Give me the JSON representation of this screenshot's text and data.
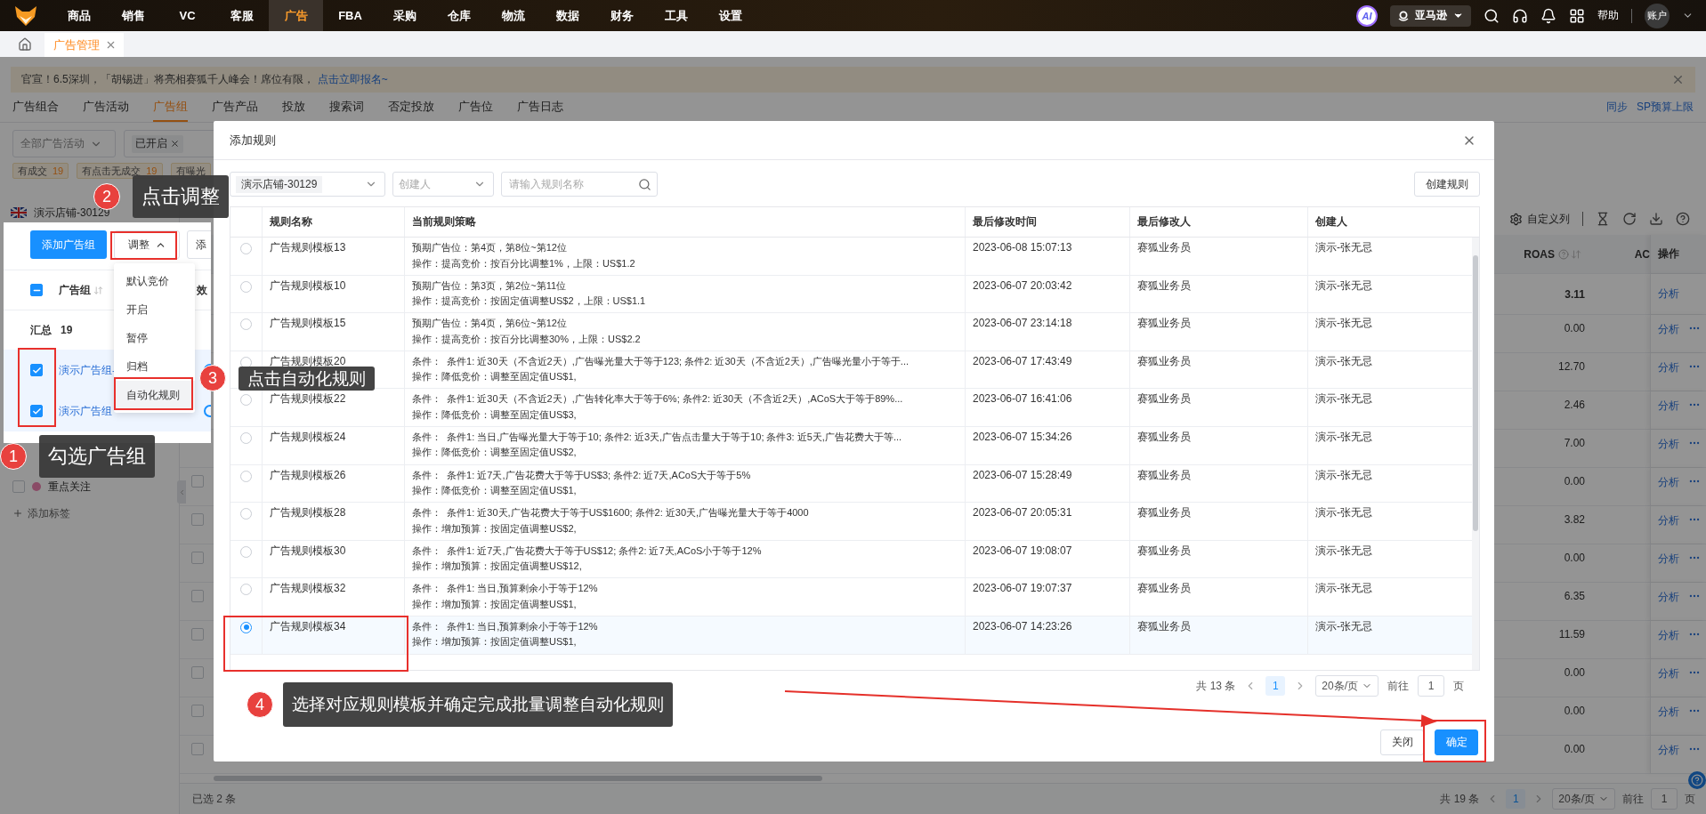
{
  "nav": {
    "items": [
      {
        "label": "商品",
        "selected": false
      },
      {
        "label": "销售",
        "selected": false
      },
      {
        "label": "VC",
        "selected": false
      },
      {
        "label": "客服",
        "selected": false
      },
      {
        "label": "广告",
        "selected": true
      },
      {
        "label": "FBA",
        "selected": false
      },
      {
        "label": "采购",
        "selected": false
      },
      {
        "label": "仓库",
        "selected": false
      },
      {
        "label": "物流",
        "selected": false
      },
      {
        "label": "数据",
        "selected": false
      },
      {
        "label": "财务",
        "selected": false
      },
      {
        "label": "工具",
        "selected": false
      },
      {
        "label": "设置",
        "selected": false
      }
    ],
    "ai": "AI",
    "platform": "亚马逊",
    "help": "帮助",
    "account": "账户"
  },
  "page_tabs": [
    {
      "label": "广告管理",
      "selected": true
    }
  ],
  "banner": {
    "text": "官宣！6.5深圳，「胡锡进」将亮相赛狐千人峰会！席位有限，",
    "link": "点击立即报名~"
  },
  "sub_tabs": [
    {
      "label": "广告组合",
      "selected": false
    },
    {
      "label": "广告活动",
      "selected": false
    },
    {
      "label": "广告组",
      "selected": true
    },
    {
      "label": "广告产品",
      "selected": false
    },
    {
      "label": "投放",
      "selected": false
    },
    {
      "label": "搜索词",
      "selected": false
    },
    {
      "label": "否定投放",
      "selected": false
    },
    {
      "label": "广告位",
      "selected": false
    },
    {
      "label": "广告日志",
      "selected": false
    }
  ],
  "sub_actions": [
    "同步",
    "SP预算上限"
  ],
  "filters": {
    "campaign": "全部广告活动",
    "status_tag": "已开启"
  },
  "quick_filters": [
    {
      "label": "有成交",
      "count": "19"
    },
    {
      "label": "有点击无成交",
      "count": "19"
    },
    {
      "label": "有曝光"
    }
  ],
  "sidebar": {
    "store": "演示店铺-30129",
    "tags": [
      {
        "label": "重点关注",
        "color": "#8a4b66",
        "checked": false
      }
    ],
    "add_tag": "添加标签"
  },
  "toolbar": {
    "custom_columns": "自定义列"
  },
  "table": {
    "columns": [
      "ROAS",
      "AC",
      "操作"
    ],
    "summary": {
      "roas": "3.11",
      "action": "分析"
    },
    "rows": [
      {
        "roas": "0.00",
        "action": "分析"
      },
      {
        "roas": "12.70",
        "action": "分析"
      },
      {
        "roas": "2.46",
        "action": "分析"
      },
      {
        "roas": "7.00",
        "action": "分析"
      },
      {
        "roas": "0.00",
        "action": "分析",
        "checked": false
      },
      {
        "roas": "3.82",
        "action": "分析",
        "checked": false
      },
      {
        "roas": "0.00",
        "action": "分析",
        "checked": false
      },
      {
        "roas": "6.35",
        "action": "分析",
        "checked": false
      },
      {
        "roas": "11.59",
        "action": "分析",
        "checked": false
      },
      {
        "roas": "0.00",
        "action": "分析",
        "checked": false
      },
      {
        "roas": "0.00",
        "action": "分析",
        "checked": false
      },
      {
        "roas": "0.00",
        "action": "分析",
        "checked": false
      }
    ]
  },
  "footer": {
    "selected": "已选 2 条",
    "total": "共 19 条",
    "page": "1",
    "page_size": "20条/页",
    "goto": "前往",
    "goto_value": "1",
    "goto_unit": "页"
  },
  "popup": {
    "add_button": "添加广告组",
    "adjust_button": "调整",
    "adjust_expanded": true,
    "next_button": "添",
    "header": {
      "label": "广告组",
      "indeterminate": true,
      "next_column": "效"
    },
    "summary": {
      "label": "汇总",
      "count": "19"
    },
    "rows": [
      {
        "name": "演示广告组-",
        "checked": true
      },
      {
        "name": "演示广告组",
        "checked": true
      }
    ],
    "menu": [
      {
        "label": "默认竞价",
        "selected": false
      },
      {
        "label": "开启",
        "selected": false
      },
      {
        "label": "暂停",
        "selected": false
      },
      {
        "label": "归档",
        "selected": false
      },
      {
        "label": "自动化规则",
        "selected": true
      }
    ]
  },
  "dialog": {
    "title": "添加规则",
    "store": "演示店铺-30129",
    "creator_placeholder": "创建人",
    "search_placeholder": "请输入规则名称",
    "create_button": "创建规则",
    "columns": [
      "规则名称",
      "当前规则策略",
      "最后修改时间",
      "最后修改人",
      "创建人"
    ],
    "rows": [
      {
        "name": "广告规则模板13",
        "strategy": [
          "预期广告位：第4页，第8位~第12位",
          "操作：提高竞价：按百分比调整1%，上限：US$1.2"
        ],
        "modified": "2023-06-08 15:07:13",
        "modifier": "赛狐业务员",
        "creator": "演示-张无忌",
        "selected": false
      },
      {
        "name": "广告规则模板10",
        "strategy": [
          "预期广告位：第3页，第2位~第11位",
          "操作：提高竞价：按固定值调整US$2，上限：US$1.1"
        ],
        "modified": "2023-06-07 20:03:42",
        "modifier": "赛狐业务员",
        "creator": "演示-张无忌",
        "selected": false
      },
      {
        "name": "广告规则模板15",
        "strategy": [
          "预期广告位：第4页，第6位~第12位",
          "操作：提高竞价：按百分比调整30%，上限：US$2.2"
        ],
        "modified": "2023-06-07 23:14:18",
        "modifier": "赛狐业务员",
        "creator": "演示-张无忌",
        "selected": false
      },
      {
        "name": "广告规则模板20",
        "strategy": [
          "条件：  条件1: 近30天（不含近2天）,广告曝光量大于等于123; 条件2: 近30天（不含近2天）,广告曝光量小于等于...",
          "操作：降低竞价：调整至固定值US$1,"
        ],
        "modified": "2023-06-07 17:43:49",
        "modifier": "赛狐业务员",
        "creator": "演示-张无忌",
        "selected": false
      },
      {
        "name": "广告规则模板22",
        "strategy": [
          "条件：  条件1: 近30天（不含近2天）,广告转化率大于等于6%; 条件2: 近30天（不含近2天）,ACoS大于等于89%...",
          "操作：降低竞价：调整至固定值US$3,"
        ],
        "modified": "2023-06-07 16:41:06",
        "modifier": "赛狐业务员",
        "creator": "演示-张无忌",
        "selected": false
      },
      {
        "name": "广告规则模板24",
        "strategy": [
          "条件：  条件1: 当日,广告曝光量大于等于10; 条件2: 近3天,广告点击量大于等于10; 条件3: 近5天,广告花费大于等...",
          "操作：降低竞价：调整至固定值US$2,"
        ],
        "modified": "2023-06-07 15:34:26",
        "modifier": "赛狐业务员",
        "creator": "演示-张无忌",
        "selected": false
      },
      {
        "name": "广告规则模板26",
        "strategy": [
          "条件：  条件1: 近7天,广告花费大于等于US$3; 条件2: 近7天,ACoS大于等于5%",
          "操作：降低竞价：调整至固定值US$1,"
        ],
        "modified": "2023-06-07 15:28:49",
        "modifier": "赛狐业务员",
        "creator": "演示-张无忌",
        "selected": false
      },
      {
        "name": "广告规则模板28",
        "strategy": [
          "条件：  条件1: 近30天,广告花费大于等于US$1600; 条件2: 近30天,广告曝光量大于等于4000",
          "操作：增加预算：按固定值调整US$2,"
        ],
        "modified": "2023-06-07 20:05:31",
        "modifier": "赛狐业务员",
        "creator": "演示-张无忌",
        "selected": false
      },
      {
        "name": "广告规则模板30",
        "strategy": [
          "条件：  条件1: 近7天,广告花费大于等于US$12; 条件2: 近7天,ACoS小于等于12%",
          "操作：增加预算：按固定值调整US$12,"
        ],
        "modified": "2023-06-07 19:08:07",
        "modifier": "赛狐业务员",
        "creator": "演示-张无忌",
        "selected": false
      },
      {
        "name": "广告规则模板32",
        "strategy": [
          "条件：  条件1: 当日,预算剩余小于等于12%",
          "操作：增加预算：按固定值调整US$1,"
        ],
        "modified": "2023-06-07 19:07:37",
        "modifier": "赛狐业务员",
        "creator": "演示-张无忌",
        "selected": false
      },
      {
        "name": "广告规则模板34",
        "strategy": [
          "条件：  条件1: 当日,预算剩余小于等于12%",
          "操作：增加预算：按固定值调整US$1,"
        ],
        "modified": "2023-06-07 14:23:26",
        "modifier": "赛狐业务员",
        "creator": "演示-张无忌",
        "selected": true
      }
    ],
    "pagination": {
      "total": "共 13 条",
      "page": "1",
      "page_size": "20条/页",
      "goto": "前往",
      "goto_value": "1",
      "goto_unit": "页"
    },
    "buttons": [
      {
        "label": "关闭",
        "kind": "default"
      },
      {
        "label": "确定",
        "kind": "primary"
      }
    ]
  },
  "annotations": [
    {
      "number": "1",
      "text": "勾选广告组"
    },
    {
      "number": "2",
      "text": "点击调整"
    },
    {
      "number": "3",
      "text": "点击自动化规则"
    },
    {
      "number": "4",
      "text": "选择对应规则模板并确定完成批量调整自动化规则"
    }
  ]
}
